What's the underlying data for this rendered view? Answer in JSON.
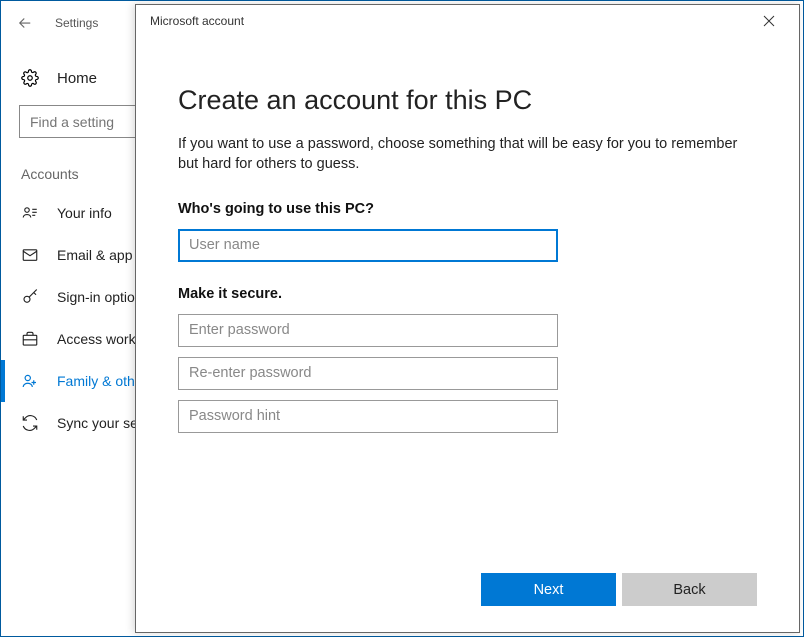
{
  "settings": {
    "title": "Settings",
    "home": "Home",
    "search_placeholder": "Find a setting",
    "section": "Accounts",
    "nav": [
      {
        "label": "Your info"
      },
      {
        "label": "Email & app accounts"
      },
      {
        "label": "Sign-in options"
      },
      {
        "label": "Access work or school"
      },
      {
        "label": "Family & other people"
      },
      {
        "label": "Sync your settings"
      }
    ]
  },
  "modal": {
    "title": "Microsoft account",
    "heading": "Create an account for this PC",
    "description": "If you want to use a password, choose something that will be easy for you to remember but hard for others to guess.",
    "q1": "Who's going to use this PC?",
    "q2": "Make it secure.",
    "username_placeholder": "User name",
    "password_placeholder": "Enter password",
    "repassword_placeholder": "Re-enter password",
    "hint_placeholder": "Password hint",
    "next": "Next",
    "back": "Back"
  }
}
